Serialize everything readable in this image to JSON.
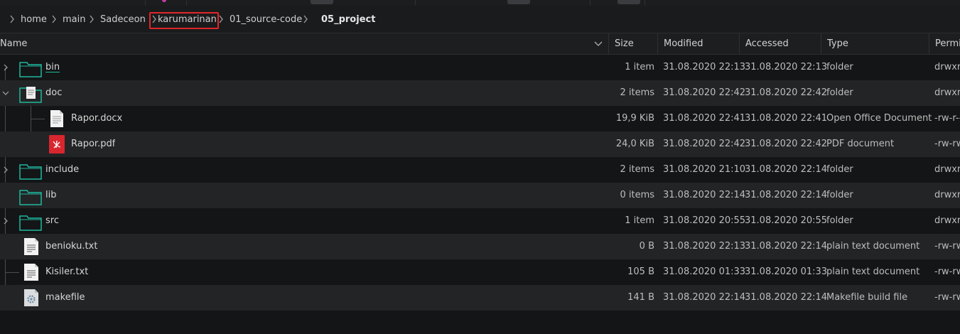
{
  "breadcrumb": {
    "items": [
      "home",
      "main",
      "Sadeceon",
      "karumarinan",
      "01_source-code",
      "05_project"
    ],
    "highlighted": "karumarinan",
    "current": "05_project"
  },
  "columns": {
    "name": "Name",
    "size": "Size",
    "modified": "Modified",
    "accessed": "Accessed",
    "type": "Type",
    "permissions": "Permi"
  },
  "files": [
    {
      "name": "bin",
      "size": "1 item",
      "modified": "31.08.2020 22:13",
      "accessed": "31.08.2020 22:13",
      "type": "folder",
      "perm": "drwxr",
      "icon": "folder-icon",
      "expander": "collapsed"
    },
    {
      "name": "doc",
      "size": "2 items",
      "modified": "31.08.2020 22:42",
      "accessed": "31.08.2020 22:42",
      "type": "folder",
      "perm": "drwxr",
      "icon": "folder-doc-icon",
      "expander": "expanded"
    },
    {
      "name": "Rapor.docx",
      "size": "19,9 KiB",
      "modified": "31.08.2020 22:41",
      "accessed": "31.08.2020 22:41",
      "type": "Open Office Document",
      "perm": "-rw-r--",
      "icon": "document-icon",
      "expander": "none"
    },
    {
      "name": "Rapor.pdf",
      "size": "24,0 KiB",
      "modified": "31.08.2020 22:42",
      "accessed": "31.08.2020 22:42",
      "type": "PDF document",
      "perm": "-rw-rw",
      "icon": "pdf-icon",
      "expander": "none"
    },
    {
      "name": "include",
      "size": "2 items",
      "modified": "31.08.2020 21:10",
      "accessed": "31.08.2020 22:14",
      "type": "folder",
      "perm": "drwxr",
      "icon": "folder-icon",
      "expander": "collapsed"
    },
    {
      "name": "lib",
      "size": "0 items",
      "modified": "31.08.2020 22:14",
      "accessed": "31.08.2020 22:14",
      "type": "folder",
      "perm": "drwxr",
      "icon": "folder-icon",
      "expander": "none"
    },
    {
      "name": "src",
      "size": "1 item",
      "modified": "31.08.2020 20:55",
      "accessed": "31.08.2020 20:55",
      "type": "folder",
      "perm": "drwxr",
      "icon": "folder-icon",
      "expander": "collapsed"
    },
    {
      "name": "benioku.txt",
      "size": "0 B",
      "modified": "31.08.2020 22:13",
      "accessed": "31.08.2020 22:14",
      "type": "plain text document",
      "perm": "-rw-rw",
      "icon": "text-file-icon",
      "expander": "none"
    },
    {
      "name": "Kisiler.txt",
      "size": "105 B",
      "modified": "31.08.2020 01:33",
      "accessed": "31.08.2020 01:33",
      "type": "plain text document",
      "perm": "-rw-rw",
      "icon": "text-file-icon",
      "expander": "none"
    },
    {
      "name": "makefile",
      "size": "141 B",
      "modified": "31.08.2020 22:14",
      "accessed": "31.08.2020 22:14",
      "type": "Makefile build file",
      "perm": "-rw-rw",
      "icon": "makefile-icon",
      "expander": "none"
    }
  ],
  "colors": {
    "background": "#141516",
    "row_alt": "#232425",
    "folder_accent": "#1fb8a0",
    "highlight_border": "#e0262b",
    "pdf_red": "#d8262f"
  }
}
